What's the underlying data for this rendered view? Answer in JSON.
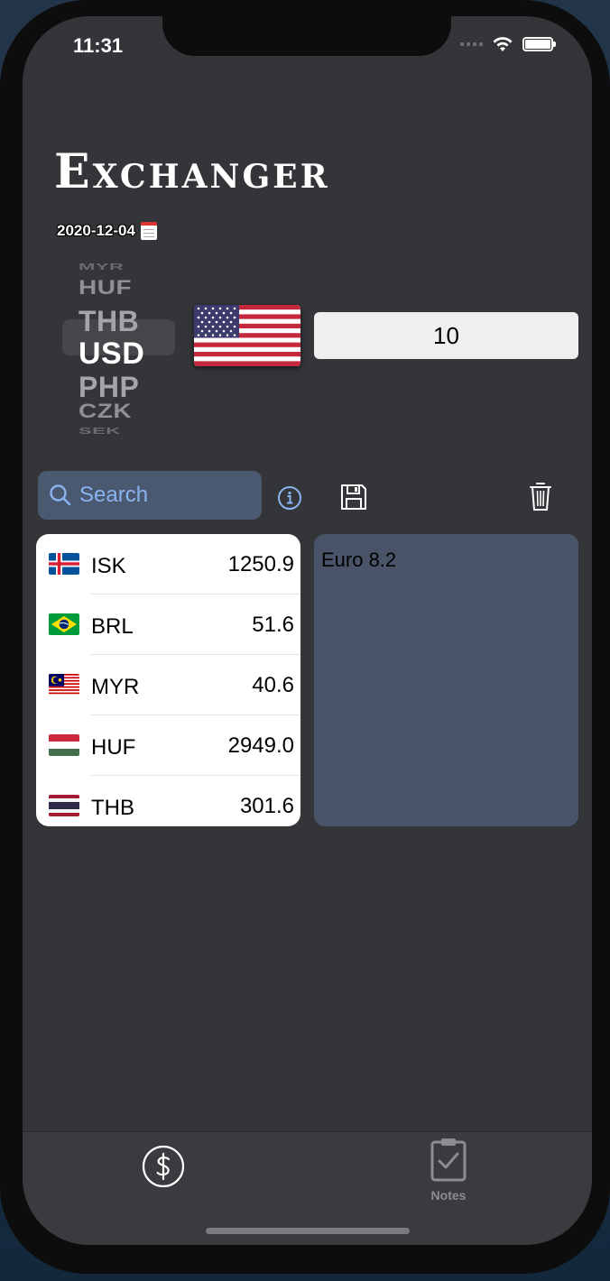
{
  "status_bar": {
    "time": "11:31"
  },
  "app": {
    "title": "Exchanger",
    "date": "2020-12-04"
  },
  "currency_picker": {
    "items": [
      "MYR",
      "HUF",
      "THB",
      "USD",
      "PHP",
      "CZK",
      "SEK"
    ],
    "selected": "USD"
  },
  "amount": {
    "value": "10"
  },
  "search": {
    "placeholder": "Search"
  },
  "rates": [
    {
      "code": "ISK",
      "value": "1250.9",
      "flag": "iceland-flag"
    },
    {
      "code": "BRL",
      "value": "51.6",
      "flag": "brazil-flag"
    },
    {
      "code": "MYR",
      "value": "40.6",
      "flag": "malaysia-flag"
    },
    {
      "code": "HUF",
      "value": "2949.0",
      "flag": "hungary-flag"
    },
    {
      "code": "THB",
      "value": "301.6",
      "flag": "thailand-flag"
    }
  ],
  "notes": {
    "text": "Euro 8.2"
  },
  "tab_bar": {
    "tabs": [
      {
        "icon": "dollar-circle-icon",
        "label": ""
      },
      {
        "icon": "clipboard-check-icon",
        "label": "Notes"
      }
    ]
  },
  "colors": {
    "background": "#333539",
    "search_bg": "#4a5870",
    "accent": "#8ab4f0",
    "notes_bg": "#4a5468"
  }
}
